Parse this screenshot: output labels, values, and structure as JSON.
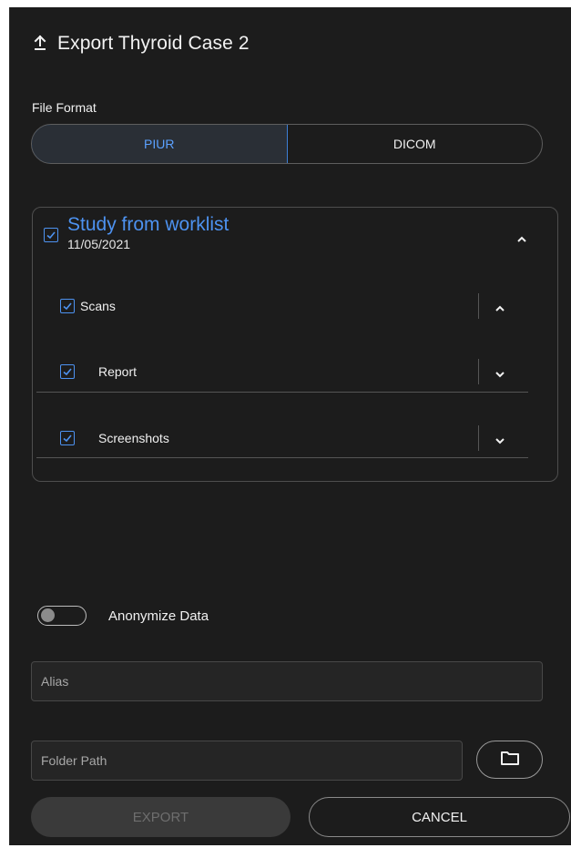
{
  "dialog": {
    "title": "Export Thyroid Case 2",
    "title_icon": "upload-icon"
  },
  "file_format": {
    "label": "File Format",
    "options": [
      "PIUR",
      "DICOM"
    ],
    "selected": "PIUR"
  },
  "study": {
    "title": "Study from worklist",
    "date": "11/05/2021",
    "checked": true,
    "expanded": true,
    "items": [
      {
        "label": "Scans",
        "checked": true,
        "chevron": "chevron-up-icon"
      },
      {
        "label": "Report",
        "checked": true,
        "chevron": "chevron-down-icon"
      },
      {
        "label": "Screenshots",
        "checked": true,
        "chevron": "chevron-down-icon"
      }
    ]
  },
  "anonymize": {
    "label": "Anonymize Data",
    "enabled": false
  },
  "alias": {
    "placeholder": "Alias",
    "value": ""
  },
  "folder": {
    "placeholder": "Folder Path",
    "value": "",
    "browse_icon": "folder-icon"
  },
  "actions": {
    "export_label": "EXPORT",
    "cancel_label": "CANCEL",
    "export_enabled": false
  },
  "colors": {
    "background": "#1c1c1c",
    "accent": "#4d92f0",
    "border": "#4e4e4e"
  }
}
